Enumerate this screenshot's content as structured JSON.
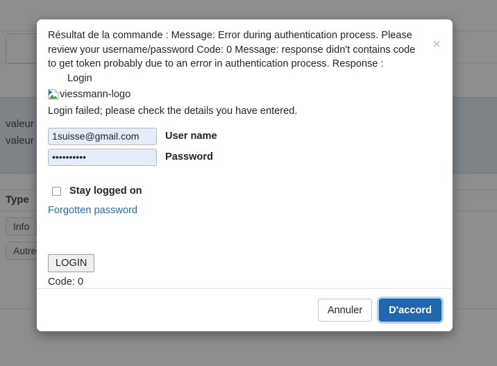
{
  "background": {
    "rows": [
      {
        "label": "valeur"
      },
      {
        "label": "valeur"
      }
    ],
    "column_header": "Type",
    "badges": [
      "Info",
      "Autre"
    ]
  },
  "dialog": {
    "close_icon": "close-icon",
    "command_result": "Résultat de la commande : Message: Error during authentication process. Please review your username/password Code: 0 Message: response didn't contains code to get token probably due to an error in authentication process. Response :",
    "login_heading": "Login",
    "logo_alt_text": "viessmann-logo",
    "logo_icon": "broken-image-icon",
    "error_message": "Login failed; please check the details you have entered.",
    "form": {
      "username": {
        "value": "1suisse@gmail.com",
        "placeholder": "",
        "label": "User name"
      },
      "password": {
        "value": "••••••••••",
        "placeholder": "",
        "label": "Password"
      },
      "stay_logged_on_label": "Stay logged on",
      "stay_logged_on_checked": false,
      "forgotten_password_label": "Forgotten password",
      "submit_label": "LOGIN"
    },
    "code_status": "Code: 0",
    "footer": {
      "cancel_label": "Annuler",
      "confirm_label": "D'accord"
    }
  },
  "colors": {
    "primary": "#2167ae",
    "link": "#1f6fb4",
    "input_autofill": "#e5ecfa",
    "row_highlight": "#dce9f2"
  }
}
